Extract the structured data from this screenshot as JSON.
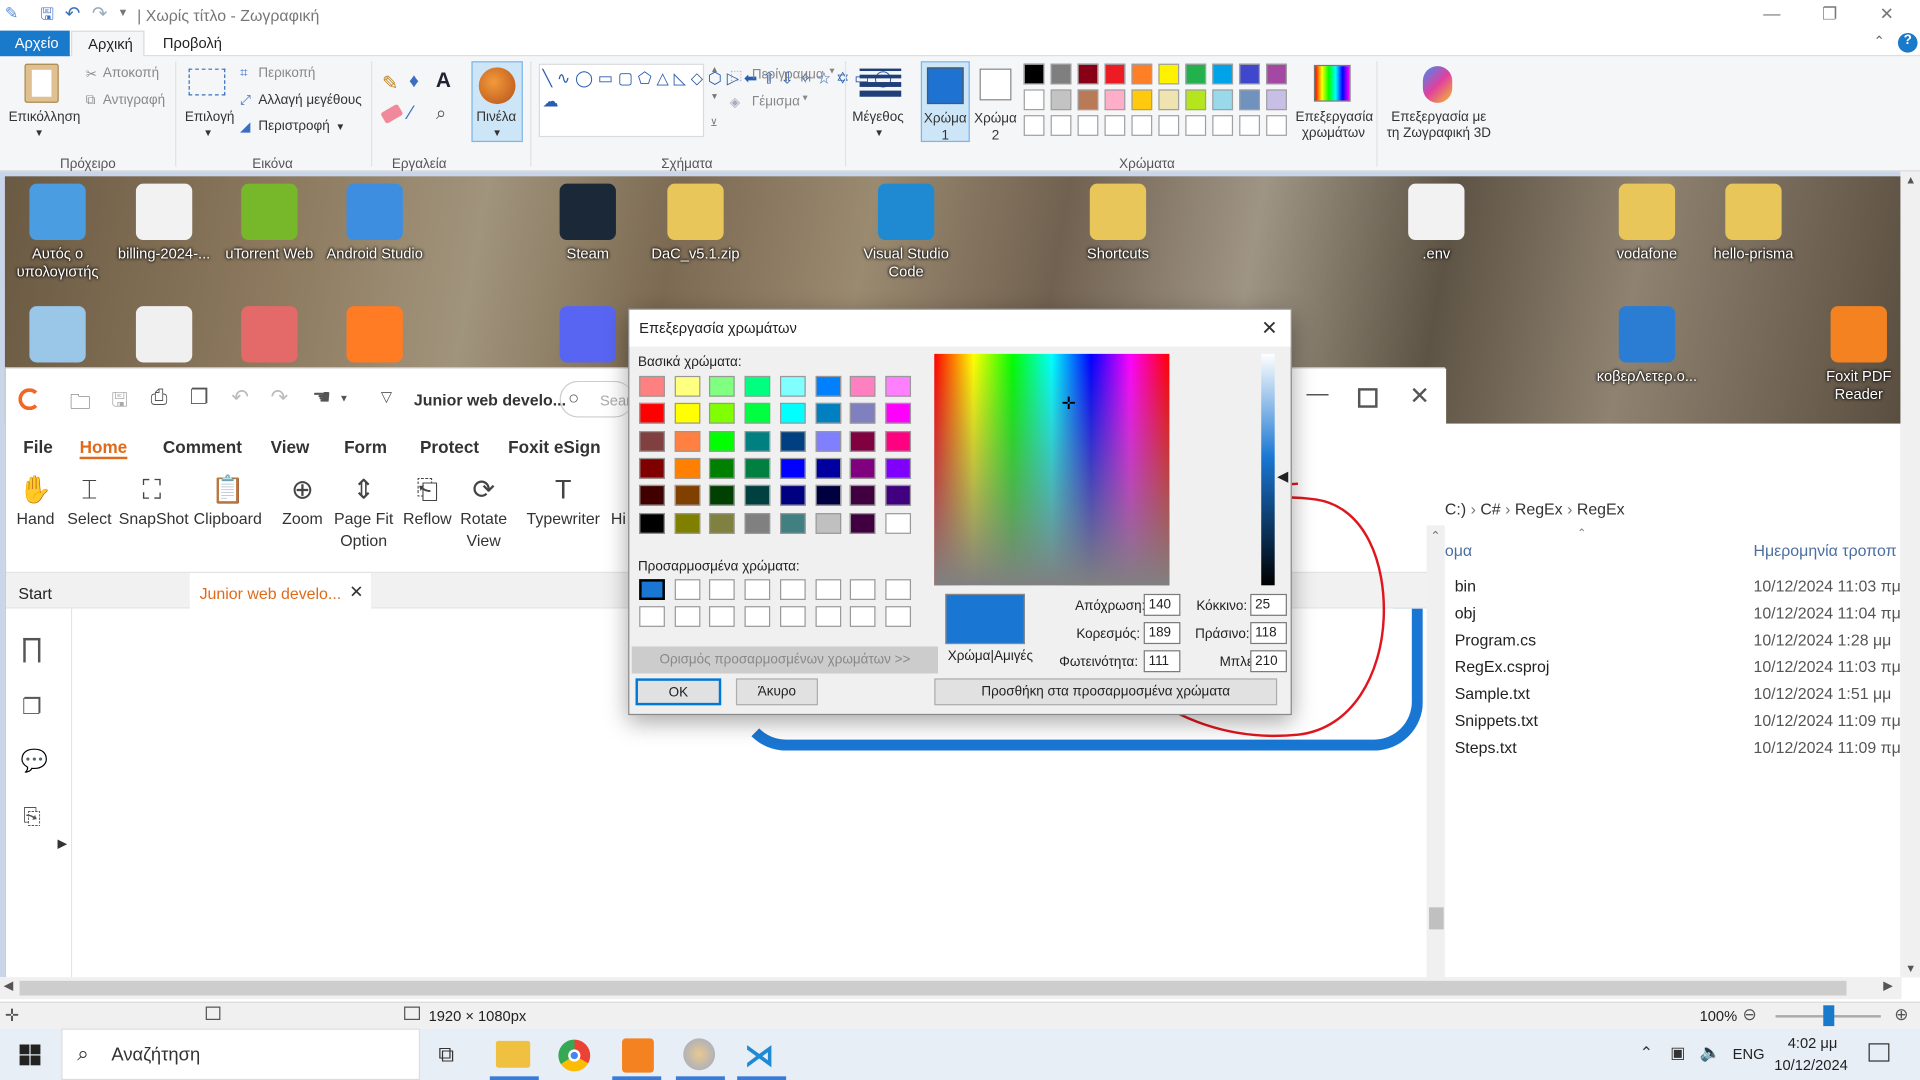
{
  "paint": {
    "title": "| Χωρίς τίτλο - Ζωγραφική",
    "tabs": [
      "Αρχείο",
      "Αρχική",
      "Προβολή"
    ],
    "ribbon": {
      "clipboard": {
        "paste": "Επικόλληση",
        "cut": "Αποκοπή",
        "copy": "Αντιγραφή",
        "group": "Πρόχειρο"
      },
      "image": {
        "select": "Επιλογή",
        "crop": "Περικοπή",
        "resize": "Αλλαγή μεγέθους",
        "rotate": "Περιστροφή",
        "group": "Εικόνα"
      },
      "tools": {
        "group": "Εργαλεία"
      },
      "brushes": "Πινέλα",
      "shapes": {
        "outline": "Περίγραμμα",
        "fill": "Γέμισμα",
        "group": "Σχήματα"
      },
      "size": "Μέγεθος",
      "color1": [
        "Χρώμα",
        "1"
      ],
      "color2": [
        "Χρώμα",
        "2"
      ],
      "colors_group": "Χρώματα",
      "edit_colors": [
        "Επεξεργασία",
        "χρωμάτων"
      ],
      "edit_3d": [
        "Επεξεργασία με",
        "τη Ζωγραφική 3D"
      ]
    },
    "palette_row1": [
      "#000000",
      "#7f7f7f",
      "#880015",
      "#ed1c24",
      "#ff7f27",
      "#fff200",
      "#22b14c",
      "#00a2e8",
      "#3f48cc",
      "#a349a4"
    ],
    "palette_row2": [
      "#ffffff",
      "#c3c3c3",
      "#b97a57",
      "#ffaec9",
      "#ffc90e",
      "#efe4b0",
      "#b5e61d",
      "#99d9ea",
      "#7092be",
      "#c8bfe7"
    ],
    "color1_value": "#1e73d2",
    "status": {
      "dimensions": "1920 × 1080px",
      "zoom": "100%"
    }
  },
  "desktop": {
    "icons_row1": [
      {
        "label": "Αυτός ο υπολογιστής",
        "color": "#4a9de0"
      },
      {
        "label": "billing-2024-...",
        "color": "#f2f2f2"
      },
      {
        "label": "uTorrent Web",
        "color": "#76b82a"
      },
      {
        "label": "Android Studio",
        "color": "#3d8ee0"
      },
      {
        "label": "Steam",
        "color": "#1b2838"
      },
      {
        "label": "DaC_v5.1.zip",
        "color": "#e8c65a"
      },
      {
        "label": "Visual Studio Code",
        "color": "#1f8ad2"
      },
      {
        "label": "Shortcuts",
        "color": "#e8c65a"
      },
      {
        "label": ".env",
        "color": "#f2f2f2"
      },
      {
        "label": "vodafone",
        "color": "#e8c65a"
      },
      {
        "label": "hello-prisma",
        "color": "#e8c65a"
      }
    ],
    "icons_row2": [
      {
        "label": "",
        "color": "#9ac6e8"
      },
      {
        "label": "",
        "color": "#f0f0f0"
      },
      {
        "label": "",
        "color": "#e46a6a"
      },
      {
        "label": "",
        "color": "#ff7b24"
      },
      {
        "label": "",
        "color": "#5865f2"
      },
      {
        "label": "κοβερΛετερ.o...",
        "color": "#2b7cd3"
      },
      {
        "label": "Foxit PDF Reader",
        "color": "#f58220"
      }
    ]
  },
  "foxit": {
    "doc_title": "Junior web develo...",
    "search_placeholder": "Sear",
    "menu": [
      "File",
      "Home",
      "Comment",
      "View",
      "Form",
      "Protect",
      "Foxit eSign"
    ],
    "tools": [
      "Hand",
      "Select",
      "SnapShot",
      "Clipboard",
      "Zoom",
      "Page Fit Option",
      "Reflow",
      "Rotate View",
      "Typewriter",
      "Hi"
    ],
    "tabs": [
      "Start",
      "Junior web develo..."
    ]
  },
  "explorer": {
    "breadcrumb": [
      "C:)",
      "C#",
      "RegEx",
      "RegEx"
    ],
    "col_name": "ομα",
    "col_date": "Ημερομηνία τροποπ",
    "files": [
      {
        "name": "bin",
        "date": "10/12/2024 11:03 πμ"
      },
      {
        "name": "obj",
        "date": "10/12/2024 11:04 πμ"
      },
      {
        "name": "Program.cs",
        "date": "10/12/2024 1:28 μμ"
      },
      {
        "name": "RegEx.csproj",
        "date": "10/12/2024 11:03 πμ"
      },
      {
        "name": "Sample.txt",
        "date": "10/12/2024 1:51 μμ"
      },
      {
        "name": "Snippets.txt",
        "date": "10/12/2024 11:09 πμ"
      },
      {
        "name": "Steps.txt",
        "date": "10/12/2024 11:09 πμ"
      }
    ]
  },
  "dialog": {
    "title": "Επεξεργασία χρωμάτων",
    "basic_label": "Βασικά χρώματα:",
    "custom_label": "Προσαρμοσμένα χρώματα:",
    "define_custom": "Ορισμός προσαρμοσμένων χρωμάτων >>",
    "ok": "OK",
    "cancel": "Άκυρο",
    "add_custom": "Προσθήκη στα προσαρμοσμένα χρώματα",
    "color_solid": "Χρώμα|Αμιγές",
    "hue_label": "Απόχρωση:",
    "hue": "140",
    "sat_label": "Κορεσμός:",
    "sat": "189",
    "lum_label": "Φωτεινότητα:",
    "lum": "111",
    "red_label": "Κόκκινο:",
    "red": "25",
    "green_label": "Πράσινο:",
    "green": "118",
    "blue_label": "Μπλε:",
    "blue": "210",
    "current_color": "#1976d2",
    "basic_colors": [
      [
        "#ff8080",
        "#ffff80",
        "#80ff80",
        "#00ff80",
        "#80ffff",
        "#0080ff",
        "#ff80c0",
        "#ff80ff"
      ],
      [
        "#ff0000",
        "#ffff00",
        "#80ff00",
        "#00ff40",
        "#00ffff",
        "#0080c0",
        "#8080c0",
        "#ff00ff"
      ],
      [
        "#804040",
        "#ff8040",
        "#00ff00",
        "#008080",
        "#004080",
        "#8080ff",
        "#800040",
        "#ff0080"
      ],
      [
        "#800000",
        "#ff8000",
        "#008000",
        "#008040",
        "#0000ff",
        "#0000a0",
        "#800080",
        "#8000ff"
      ],
      [
        "#400000",
        "#804000",
        "#004000",
        "#004040",
        "#000080",
        "#000040",
        "#400040",
        "#400080"
      ],
      [
        "#000000",
        "#808000",
        "#808040",
        "#808080",
        "#408080",
        "#c0c0c0",
        "#400040",
        "#ffffff"
      ]
    ]
  },
  "taskbar": {
    "search": "Αναζήτηση",
    "lang": "ENG",
    "time": "4:02 μμ",
    "date": "10/12/2024"
  }
}
